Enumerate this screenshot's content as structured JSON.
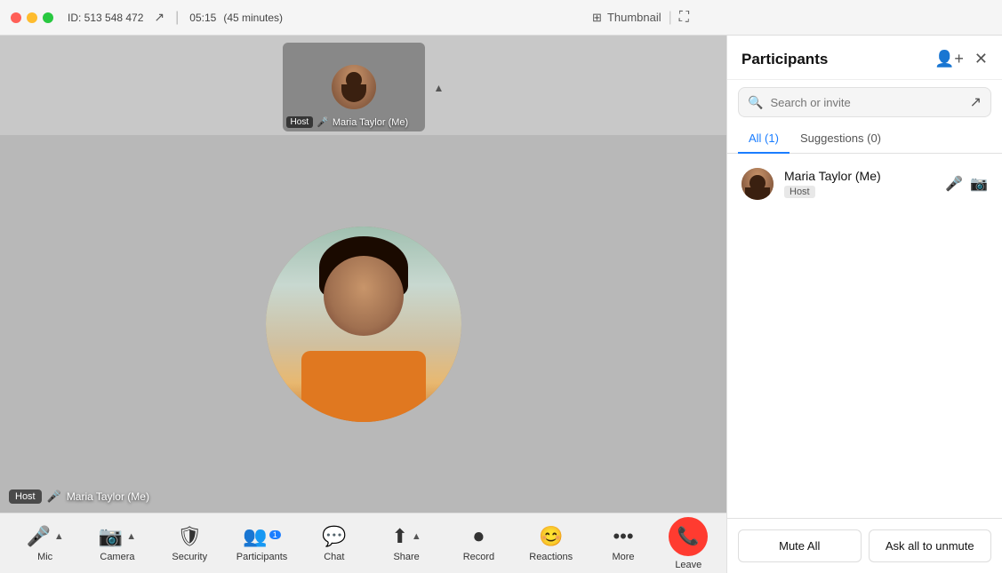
{
  "titlebar": {
    "meeting_id_label": "ID: 513 548 472",
    "time": "05:15",
    "duration": "(45 minutes)",
    "thumbnail_label": "Thumbnail",
    "share_icon": "↗",
    "fullscreen_icon": "⛶"
  },
  "toolbar": {
    "mic_label": "Mic",
    "camera_label": "Camera",
    "security_label": "Security",
    "participants_label": "Participants",
    "participants_count": "1",
    "chat_label": "Chat",
    "share_label": "Share",
    "record_label": "Record",
    "reactions_label": "Reactions",
    "more_label": "More",
    "leave_label": "Leave"
  },
  "video": {
    "host_badge": "Host",
    "participant_name": "Maria Taylor (Me)"
  },
  "thumbnail": {
    "host_badge": "Host",
    "participant_name": "Maria Taylor (Me)"
  },
  "panel": {
    "title": "Participants",
    "search_placeholder": "Search or invite",
    "tab_all": "All (1)",
    "tab_suggestions": "Suggestions (0)",
    "participant_name": "Maria Taylor (Me)",
    "participant_role": "Host",
    "mute_all_label": "Mute All",
    "ask_unmute_label": "Ask all to unmute"
  }
}
